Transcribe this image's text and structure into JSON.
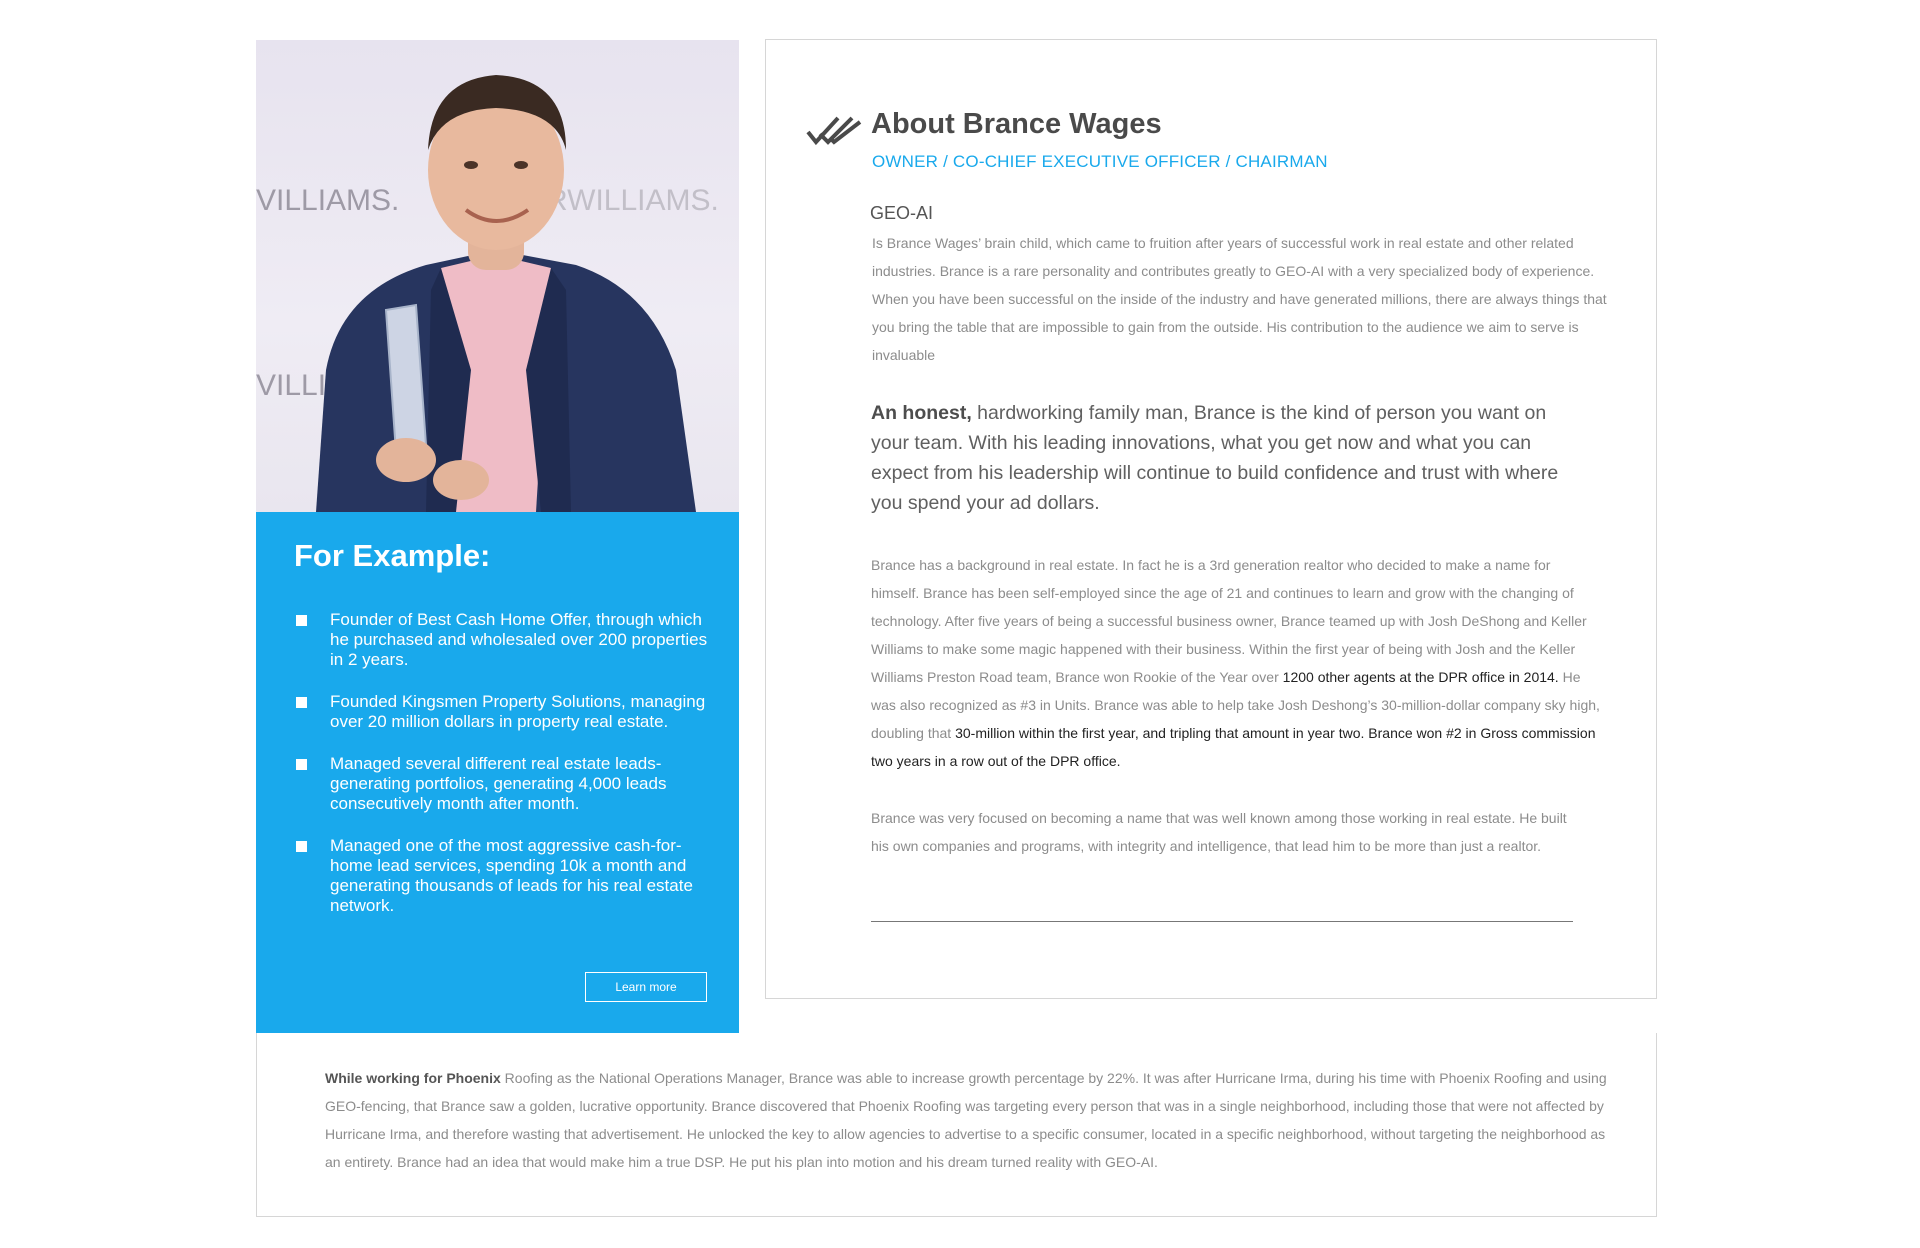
{
  "colors": {
    "accent": "#19a9ec",
    "heading": "#4a4a4a",
    "body_text": "#8c8c8c",
    "border": "#d6d6d6"
  },
  "profile": {
    "photo_alt": "Brance Wages holding an award",
    "backdrop_text": [
      "VILLIAMS.",
      "RWILLIAMS.",
      "VILLIA"
    ]
  },
  "example": {
    "title": "For Example:",
    "items": [
      "Founder of Best Cash Home Offer, through which he purchased and wholesaled over 200 properties in 2 years.",
      "Founded Kingsmen Property Solutions, managing over 20 million dollars in property real estate.",
      "Managed several different real estate leads-generating portfolios, generating 4,000 leads consecutively month after month.",
      "Managed one of the most aggressive cash-for-home lead services, spending 10k a month and generating thousands of leads for his real estate network."
    ],
    "button_label": "Learn more"
  },
  "about": {
    "title": "About Brance Wages",
    "subtitle": "OWNER / CO-CHIEF EXECUTIVE OFFICER / CHAIRMAN",
    "geo_heading": "GEO-AI",
    "geo_text": "Is Brance Wages’ brain child, which came to fruition after years of successful work in real estate and other related industries. Brance is a rare personality and contributes greatly to GEO-AI with a very specialized body of experience. When you have been successful on the inside of the industry and have generated millions, there are always things that you bring the table that are impossible to gain from the outside. His contribution to the audience we aim to serve is invaluable",
    "quote_lead": "An honest,",
    "quote_rest": " hardworking family man, Brance is the kind of person you want on your team. With his leading innovations, what you get now and what you can expect from his leadership will continue to build confidence and trust with where you spend your ad dollars.",
    "bg_part1": "Brance has a background in real estate. In fact he is a 3rd generation realtor who decided to make a name for himself. Brance has been self-employed since the age of 21 and continues to learn and grow with the changing of technology. After five years of being a successful business owner, Brance teamed up with Josh DeShong and Keller Williams to make some magic happened with their business. Within the first year of being with Josh and the Keller Williams Preston Road team, Brance won Rookie of the Year over ",
    "bg_part2": "1200 other agents at the DPR office in 2014.",
    "bg_part3": " He was also recognized as #3 in Units. Brance was able to help take Josh Deshong’s 30-million-dollar company sky high, doubling that ",
    "bg_part4": "30-million within the first year, and tripling that amount in year two. Brance won #2 in Gross commission two years in a row out of the DPR office.",
    "focus_text": "Brance was very focused on becoming a name that was well known among those working in real estate. He built his own companies and programs, with integrity and intelligence, that lead him to be more than just a realtor."
  },
  "phoenix": {
    "lead": "While working for Phoenix",
    "text": " Roofing as the National Operations Manager, Brance was able to increase growth percentage by 22%. It was after Hurricane Irma, during his time with Phoenix Roofing and using GEO-fencing, that Brance saw a golden, lucrative opportunity. Brance discovered that Phoenix Roofing was targeting every person that was in a single neighborhood, including those that were not affected by Hurricane Irma, and therefore wasting that advertisement. He unlocked the key to allow agencies to advertise to a specific consumer, located in a specific neighborhood, without targeting the neighborhood as an entirety. Brance had an idea that would make him a true DSP. He put his plan into motion and his dream turned reality with GEO-AI."
  }
}
